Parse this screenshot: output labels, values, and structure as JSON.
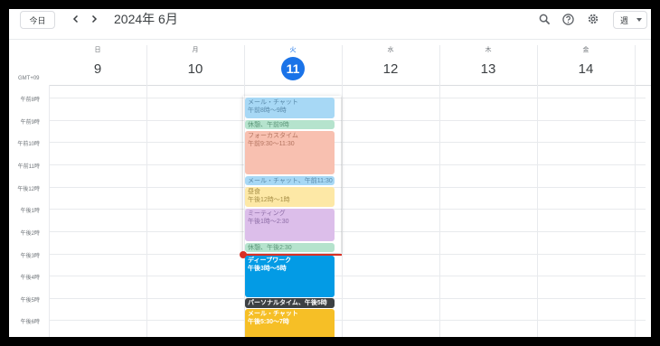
{
  "header": {
    "today_label": "今日",
    "prev_icon": "chevron-left-icon",
    "next_icon": "chevron-right-icon",
    "title": "2024年 6月",
    "search_icon": "search-icon",
    "help_icon": "help-icon",
    "settings_icon": "gear-icon",
    "view_label": "週"
  },
  "days": [
    {
      "dow": "日",
      "num": "9"
    },
    {
      "dow": "月",
      "num": "10"
    },
    {
      "dow": "火",
      "num": "11"
    },
    {
      "dow": "水",
      "num": "12"
    },
    {
      "dow": "木",
      "num": "13"
    },
    {
      "dow": "金",
      "num": "14"
    }
  ],
  "timezone": "GMT+09",
  "hours": [
    "午前8時",
    "午前9時",
    "午前10時",
    "午前11時",
    "午後12時",
    "午後1時",
    "午後2時",
    "午後3時",
    "午後4時",
    "午後5時",
    "午後6時"
  ],
  "events": [
    {
      "title": "メール・チャット",
      "time": "午前8時～9時"
    },
    {
      "title": "休憩、午前9時",
      "time": ""
    },
    {
      "title": "フォーカスタイム",
      "time": "午前9:30～11:30"
    },
    {
      "title": "メール・チャット、午前11:30",
      "time": ""
    },
    {
      "title": "昼食",
      "time": "午後12時～1時"
    },
    {
      "title": "ミーティング",
      "time": "午後1時～2:30"
    },
    {
      "title": "休憩、午後2:30",
      "time": ""
    },
    {
      "title": "ディープワーク",
      "time": "午後3時～5時"
    },
    {
      "title": "パーソナルタイム、午後5時",
      "time": ""
    },
    {
      "title": "メール・チャット",
      "time": "午後5:30～7時"
    }
  ],
  "colors": {
    "today_accent": "#1a73e8",
    "now_indicator": "#d93025",
    "deep_work": "#039be5",
    "personal_time": "#3c4043",
    "email_chat_evening": "#f6bf26"
  }
}
